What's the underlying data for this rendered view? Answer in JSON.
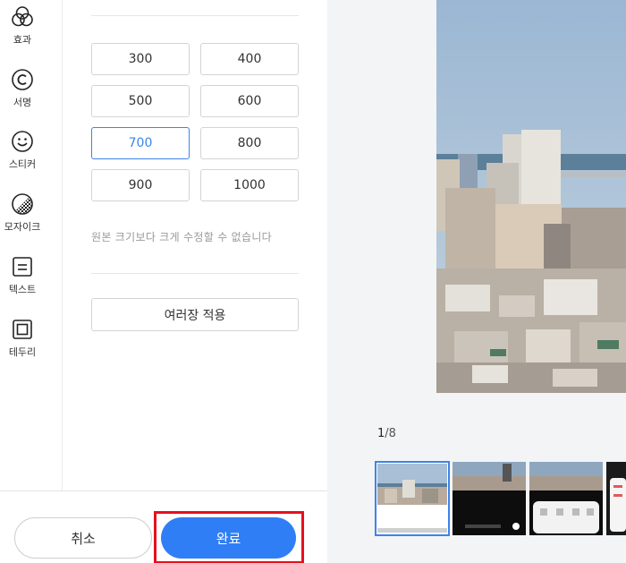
{
  "sidebar": {
    "tools": [
      {
        "label": "효과",
        "icon": "effects-icon"
      },
      {
        "label": "서명",
        "icon": "copyright-icon"
      },
      {
        "label": "스티커",
        "icon": "smiley-icon"
      },
      {
        "label": "모자이크",
        "icon": "mosaic-icon"
      },
      {
        "label": "텍스트",
        "icon": "text-icon"
      },
      {
        "label": "테두리",
        "icon": "border-icon"
      }
    ]
  },
  "resize": {
    "sizes": [
      "300",
      "400",
      "500",
      "600",
      "700",
      "800",
      "900",
      "1000"
    ],
    "selected": "700",
    "note": "원본 크기보다 크게 수정할 수 없습니다",
    "apply_multiple_label": "여러장 적용"
  },
  "actions": {
    "cancel_label": "취소",
    "done_label": "완료"
  },
  "preview": {
    "page_current": "1",
    "page_total": "/8"
  },
  "colors": {
    "accent": "#2f7ef5",
    "selected_border": "#3b84e8",
    "highlight": "#e8101e"
  }
}
